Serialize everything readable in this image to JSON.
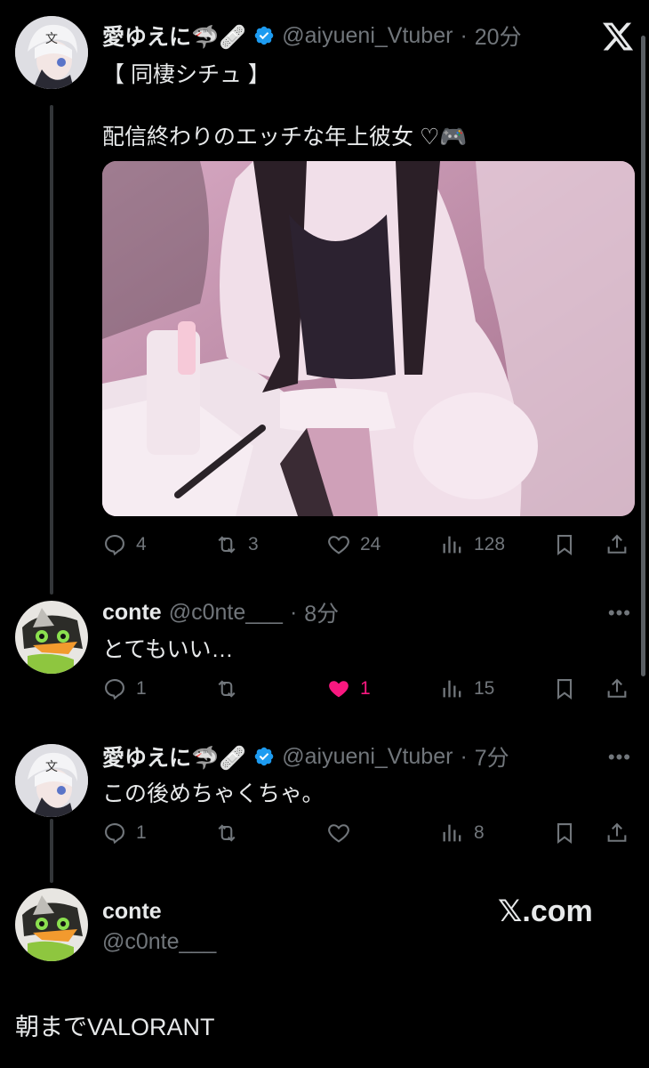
{
  "post1": {
    "name": "愛ゆえに🦈🩹",
    "handle": "@aiyueni_Vtuber",
    "time": "20分",
    "line1": "【 同棲シチュ 】",
    "line2": "配信終わりのエッチな年上彼女 ♡🎮",
    "image_alt": "photo-thumbnail",
    "stats": {
      "replies": "4",
      "reposts": "3",
      "likes": "24",
      "views": "128"
    }
  },
  "reply1": {
    "name": "conte",
    "handle": "@c0nte___",
    "time": "8分",
    "text": "とてもいい…",
    "stats": {
      "replies": "1",
      "reposts": "",
      "likes": "1",
      "views": "15"
    },
    "liked_color": "#f91880"
  },
  "reply2": {
    "name": "愛ゆえに🦈🩹",
    "handle": "@aiyueni_Vtuber",
    "time": "7分",
    "text": "この後めちゃくちゃ。",
    "stats": {
      "replies": "1",
      "reposts": "",
      "likes": "",
      "views": "8"
    }
  },
  "composer": {
    "name": "conte",
    "handle": "@c0nte___",
    "brand": "𝕏.com",
    "text": "朝までVALORANT"
  },
  "colors": {
    "background": "#000000",
    "text": "#e7e9ea",
    "muted": "#71767b",
    "verified": "#1d9bf0",
    "like": "#f91880"
  }
}
